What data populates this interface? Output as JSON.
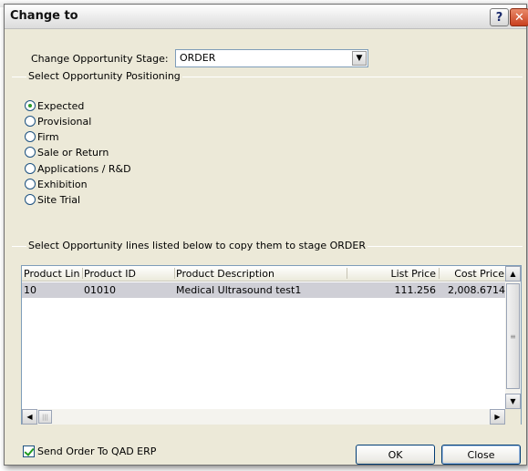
{
  "window": {
    "title": "Change to",
    "help_label": "?",
    "close_label": "✕"
  },
  "stage": {
    "label": "Change Opportunity Stage:",
    "value": "ORDER",
    "dropdown_glyph": "▼"
  },
  "positioning": {
    "group_label": "Select Opportunity Positioning",
    "options": [
      {
        "label": "Expected",
        "selected": true
      },
      {
        "label": "Provisional",
        "selected": false
      },
      {
        "label": "Firm",
        "selected": false
      },
      {
        "label": "Sale or Return",
        "selected": false
      },
      {
        "label": "Applications / R&D",
        "selected": false
      },
      {
        "label": "Exhibition",
        "selected": false
      },
      {
        "label": "Site Trial",
        "selected": false
      }
    ]
  },
  "lines": {
    "group_label": "Select Opportunity lines listed below to copy them to stage ORDER",
    "columns": [
      "Product Line",
      "Product ID",
      "Product Description",
      "List Price",
      "Cost Price"
    ],
    "rows": [
      [
        "10",
        "01010",
        "Medical Ultrasound test1",
        "111.256",
        "2,008.6714"
      ]
    ]
  },
  "scrollbar": {
    "up": "▲",
    "down": "▼",
    "left": "◀",
    "right": "▶",
    "grip": "≡",
    "hgrip": "|||"
  },
  "footer": {
    "checkbox_label": "Send Order To QAD ERP",
    "checkbox_checked": true,
    "ok_label": "OK",
    "close_label": "Close"
  },
  "colors": {
    "dialog_bg": "#ece9d8",
    "selected_row": "#cfcfd6",
    "radio_dot": "#2a9a2a",
    "close_button": "#c9401f"
  }
}
